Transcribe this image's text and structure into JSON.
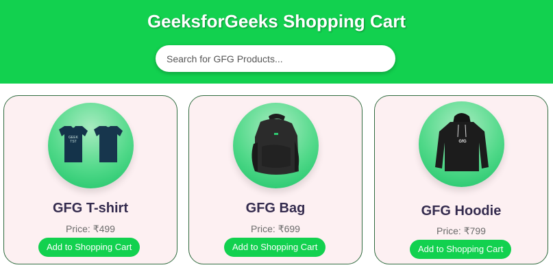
{
  "header": {
    "title": "GeeksforGeeks Shopping Cart",
    "search_placeholder": "Search for GFG Products..."
  },
  "products": [
    {
      "name": "GFG T-shirt",
      "price": "Price: ₹499",
      "button": "Add to Shopping Cart",
      "image_icon": "tshirt-icon"
    },
    {
      "name": "GFG Bag",
      "price": "Price: ₹699",
      "button": "Add to Shopping Cart",
      "image_icon": "backpack-icon"
    },
    {
      "name": "GFG Hoodie",
      "price": "Price: ₹799",
      "button": "Add to Shopping Cart",
      "image_icon": "hoodie-icon"
    }
  ],
  "colors": {
    "accent": "#12d14f",
    "card_background": "#fdf0f2",
    "card_border": "#2f6b3e",
    "product_name": "#342b4e",
    "price": "#6b6b6b"
  }
}
